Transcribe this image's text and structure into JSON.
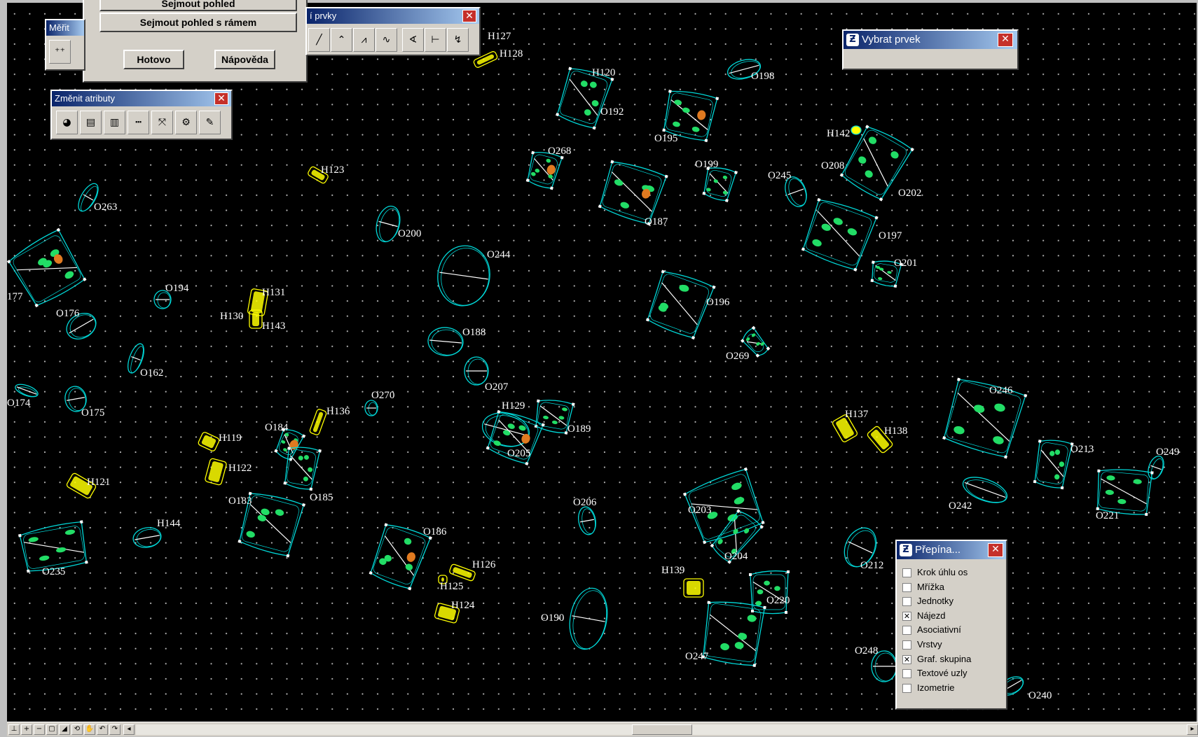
{
  "colors": {
    "outline": "#00d8d8",
    "fill": "#22dd66",
    "highlight": "#ffff00",
    "orange": "#e07a20",
    "label": "#ffffff"
  },
  "features": [
    {
      "label": "H127"
    },
    {
      "label": "H128"
    },
    {
      "label": "H120"
    },
    {
      "label": "O192"
    },
    {
      "label": "O198"
    },
    {
      "label": "O195"
    },
    {
      "label": "H142"
    },
    {
      "label": "O208"
    },
    {
      "label": "O202"
    },
    {
      "label": "O268"
    },
    {
      "label": "O199"
    },
    {
      "label": "O245"
    },
    {
      "label": "H123"
    },
    {
      "label": "O187"
    },
    {
      "label": "O263"
    },
    {
      "label": "O200"
    },
    {
      "label": "O197"
    },
    {
      "label": "O244"
    },
    {
      "label": "O201"
    },
    {
      "label": "O194"
    },
    {
      "label": "H131"
    },
    {
      "label": "177"
    },
    {
      "label": "O196"
    },
    {
      "label": "O176"
    },
    {
      "label": "H130"
    },
    {
      "label": "H143"
    },
    {
      "label": "O188"
    },
    {
      "label": "O269"
    },
    {
      "label": "O162"
    },
    {
      "label": "O207"
    },
    {
      "label": "O174"
    },
    {
      "label": "O175"
    },
    {
      "label": "O270"
    },
    {
      "label": "H129"
    },
    {
      "label": "O246"
    },
    {
      "label": "H136"
    },
    {
      "label": "H137"
    },
    {
      "label": "O184"
    },
    {
      "label": "O189"
    },
    {
      "label": "H119"
    },
    {
      "label": "H138"
    },
    {
      "label": "O205"
    },
    {
      "label": "O213"
    },
    {
      "label": "O249"
    },
    {
      "label": "H122"
    },
    {
      "label": "H121"
    },
    {
      "label": "O185"
    },
    {
      "label": "O183"
    },
    {
      "label": "O206"
    },
    {
      "label": "O242"
    },
    {
      "label": "O203"
    },
    {
      "label": "O221"
    },
    {
      "label": "H144"
    },
    {
      "label": "O186"
    },
    {
      "label": "O204"
    },
    {
      "label": "O212"
    },
    {
      "label": "O235"
    },
    {
      "label": "H126"
    },
    {
      "label": "H139"
    },
    {
      "label": "H125"
    },
    {
      "label": "O220"
    },
    {
      "label": "H124"
    },
    {
      "label": "O190"
    },
    {
      "label": "O247"
    },
    {
      "label": "O248"
    },
    {
      "label": "O240"
    }
  ],
  "dialog_view": {
    "button_top": "Sejmout pohled",
    "button_frame": "Sejmout pohled s rámem",
    "done": "Hotovo",
    "help": "Nápověda"
  },
  "toolbar_prvky": {
    "title": "í prvky",
    "close": "✕"
  },
  "toolbar_merit": {
    "title": "Měřit"
  },
  "toolbar_atributy": {
    "title": "Změnit atributy",
    "close": "✕"
  },
  "vybrat": {
    "title": "Vybrat prvek",
    "close": "✕",
    "icon": "microstation-icon"
  },
  "prepinace": {
    "title": "Přepína...",
    "close": "✕",
    "items": [
      {
        "label": "Krok úhlu os",
        "checked": false
      },
      {
        "label": "Mřížka",
        "checked": false
      },
      {
        "label": "Jednotky",
        "checked": false
      },
      {
        "label": "Nájezd",
        "checked": true
      },
      {
        "label": "Asociativní",
        "checked": false
      },
      {
        "label": "Vrstvy",
        "checked": false
      },
      {
        "label": "Graf. skupina",
        "checked": true
      },
      {
        "label": "Textové uzly",
        "checked": false
      },
      {
        "label": "Izometrie",
        "checked": false
      }
    ]
  },
  "check_mark": "✕"
}
